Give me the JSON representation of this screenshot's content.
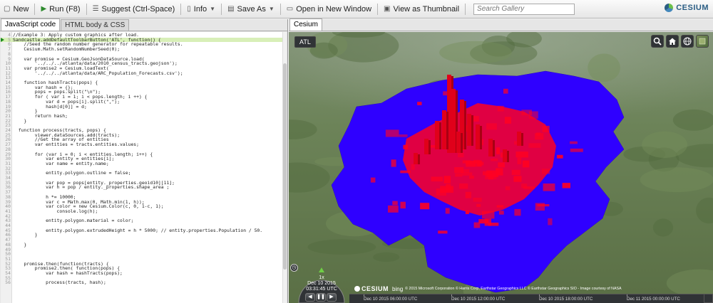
{
  "toolbar": {
    "new_label": "New",
    "run_label": "Run (F8)",
    "suggest_label": "Suggest (Ctrl-Space)",
    "info_label": "Info",
    "save_as_label": "Save As",
    "open_window_label": "Open in New Window",
    "thumbnail_label": "View as Thumbnail",
    "search_placeholder": "Search Gallery",
    "logo_text": "CESIUM"
  },
  "left_panel": {
    "tabs": [
      {
        "label": "JavaScript code",
        "active": true
      },
      {
        "label": "HTML body & CSS",
        "active": false
      }
    ],
    "highlighted_line": 5,
    "code": [
      {
        "n": "4",
        "t": "//Example 3: Apply custom graphics after load."
      },
      {
        "n": "5",
        "t": "Sandcastle.addDefaultToolbarButton('ATL', function() {"
      },
      {
        "n": "6",
        "t": "    //Seed the random number generator for repeatable results."
      },
      {
        "n": "7",
        "t": "    Cesium.Math.setRandomNumberSeed(0);"
      },
      {
        "n": "8",
        "t": ""
      },
      {
        "n": "9",
        "t": "    var promise = Cesium.GeoJsonDataSource.load("
      },
      {
        "n": "10",
        "t": "        '../../../atlanta/data/2010_census_tracts.geojson');"
      },
      {
        "n": "11",
        "t": "    var promise2 = Cesium.loadText("
      },
      {
        "n": "12",
        "t": "        '../../../atlanta/data/ARC_Population_Forecasts.csv');"
      },
      {
        "n": "13",
        "t": ""
      },
      {
        "n": "14",
        "t": "    function hashTracts(pops) {"
      },
      {
        "n": "15",
        "t": "        var hash = {};"
      },
      {
        "n": "16",
        "t": "        pops = pops.split(\"\\n\");"
      },
      {
        "n": "17",
        "t": "        for ( var i = 1; i < pops.length; i ++) {"
      },
      {
        "n": "18",
        "t": "            var d = pops[i].split(\",\");"
      },
      {
        "n": "19",
        "t": "            hash[d[0]] = d;"
      },
      {
        "n": "20",
        "t": "        }"
      },
      {
        "n": "21",
        "t": "        return hash;"
      },
      {
        "n": "22",
        "t": "    }"
      },
      {
        "n": "23",
        "t": ""
      },
      {
        "n": "24",
        "t": "  function process(tracts, pops) {"
      },
      {
        "n": "25",
        "t": "        viewer.dataSources.add(tracts);"
      },
      {
        "n": "26",
        "t": "        //Get the array of entities"
      },
      {
        "n": "27",
        "t": "        var entities = tracts.entities.values;"
      },
      {
        "n": "28",
        "t": ""
      },
      {
        "n": "29",
        "t": "        for (var i = 0; i < entities.length; i++) {"
      },
      {
        "n": "30",
        "t": "            var entity = entities[i];"
      },
      {
        "n": "31",
        "t": "            var name = entity.name;"
      },
      {
        "n": "32",
        "t": ""
      },
      {
        "n": "33",
        "t": "            entity.polygon.outline = false;"
      },
      {
        "n": "34",
        "t": ""
      },
      {
        "n": "35",
        "t": "            var pop = pops[entity._properties.geoid10][11];"
      },
      {
        "n": "36",
        "t": "            var h = pop / entity._properties.shape_area ;"
      },
      {
        "n": "37",
        "t": ""
      },
      {
        "n": "38",
        "t": "            h *= 10000;"
      },
      {
        "n": "39",
        "t": "            var c = Math.max(0, Math.min(1, h));"
      },
      {
        "n": "40",
        "t": "            var color = new Cesium.Color(c, 0, 1-c, 1);"
      },
      {
        "n": "41",
        "t": "                console.log(h);"
      },
      {
        "n": "42",
        "t": ""
      },
      {
        "n": "43",
        "t": "            entity.polygon.material = color;"
      },
      {
        "n": "44",
        "t": ""
      },
      {
        "n": "45",
        "t": "            entity.polygon.extrudedHeight = h * 5000; // entity.properties.Population / 50."
      },
      {
        "n": "46",
        "t": "        }"
      },
      {
        "n": "47",
        "t": ""
      },
      {
        "n": "48",
        "t": "    }"
      },
      {
        "n": "49",
        "t": ""
      },
      {
        "n": "50",
        "t": ""
      },
      {
        "n": "51",
        "t": ""
      },
      {
        "n": "52",
        "t": "    promise.then(function(tracts) {"
      },
      {
        "n": "53",
        "t": "        promise2.then( function(pops) {"
      },
      {
        "n": "54",
        "t": "            var hash = hashTracts(pops);"
      },
      {
        "n": "55",
        "t": ""
      },
      {
        "n": "56",
        "t": "            process(tracts, hash);"
      }
    ]
  },
  "right_panel": {
    "tab_label": "Cesium",
    "toolbar_button": "ATL",
    "viewer_icons": [
      "search-icon",
      "home-icon",
      "globe-icon",
      "layers-icon"
    ],
    "credit_logo": "CESIUM",
    "credit_bing": "bing",
    "credit_text": "© 2015 Microsoft Corporation © Harris Corp, Earthstar Geographics LLC © Earthstar Geographics SIO - Image courtesy of NASA",
    "animation": {
      "speed": "1x",
      "date": "Dec 10 2015",
      "time": "03:31:45 UTC"
    },
    "timeline_labels": [
      "Dec 10 2015 06:00:00 UTC",
      "Dec 10 2015 12:00:00 UTC",
      "Dec 10 2015 18:00:00 UTC",
      "Dec 11 2015 00:00:00 UTC"
    ],
    "colors": {
      "low_density": "#2f00ff",
      "high_density": "#ff0022",
      "terrain": "#5f7a4c",
      "widget_bg": "#303336"
    }
  }
}
